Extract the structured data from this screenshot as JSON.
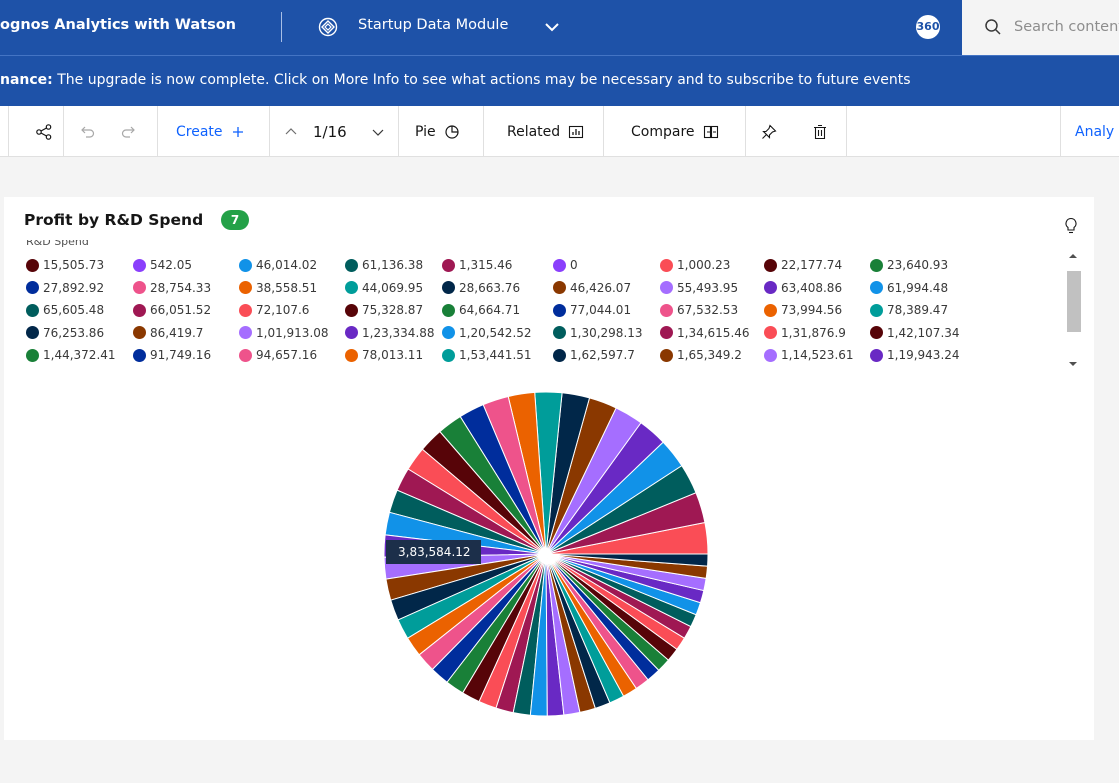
{
  "header": {
    "app_title": "ognos Analytics with Watson",
    "module_name": "Startup Data Module",
    "badge": "360",
    "search_placeholder": "Search content"
  },
  "notice": {
    "label": "nance:",
    "message": " The upgrade is now complete. Click on More Info to see what actions may be necessary and to subscribe to future events"
  },
  "toolbar": {
    "create_label": "Create",
    "page_indicator": "1/16",
    "pie_label": "Pie",
    "related_label": "Related",
    "compare_label": "Compare",
    "analyze_label": "Analy"
  },
  "card": {
    "title": "Profit by R&D Spend",
    "badge": "7",
    "legend_title": "R&D Spend"
  },
  "chart_data": {
    "type": "pie",
    "title": "Profit by R&D Spend",
    "legend_title": "R&D Spend",
    "legend_placement": "top",
    "palette": [
      "#570408",
      "#8a3ffc",
      "#1192e8",
      "#005d5d",
      "#9f1853",
      "#8a3ffc",
      "#fa4d56",
      "#570408",
      "#198038",
      "#002d9c",
      "#ee538b",
      "#eb6200",
      "#009d9a",
      "#012749",
      "#8a3800",
      "#a56eff",
      "#6929c4",
      "#1192e8"
    ],
    "categories": [
      "15,505.73",
      "542.05",
      "46,014.02",
      "61,136.38",
      "1,315.46",
      "0",
      "1,000.23",
      "22,177.74",
      "23,640.93",
      "27,892.92",
      "28,754.33",
      "38,558.51",
      "44,069.95",
      "28,663.76",
      "46,426.07",
      "55,493.95",
      "63,408.86",
      "61,994.48",
      "65,605.48",
      "66,051.52",
      "72,107.6",
      "75,328.87",
      "64,664.71",
      "77,044.01",
      "67,532.53",
      "73,994.56",
      "78,389.47",
      "76,253.86",
      "86,419.7",
      "1,01,913.08",
      "1,23,334.88",
      "1,20,542.52",
      "1,30,298.13",
      "1,34,615.46",
      "1,31,876.9",
      "1,42,107.34",
      "1,44,372.41",
      "91,749.16",
      "94,657.16",
      "78,013.11",
      "1,53,441.51",
      "1,62,597.7",
      "1,65,349.2",
      "1,14,523.61",
      "1,19,943.24"
    ],
    "legend_colors": [
      "#570408",
      "#8a3ffc",
      "#1192e8",
      "#005d5d",
      "#9f1853",
      "#8a3ffc",
      "#fa4d56",
      "#570408",
      "#198038",
      "#002d9c",
      "#ee538b",
      "#eb6200",
      "#009d9a",
      "#012749",
      "#8a3800",
      "#a56eff",
      "#6929c4",
      "#1192e8",
      "#005d5d",
      "#9f1853",
      "#fa4d56",
      "#570408",
      "#198038",
      "#002d9c",
      "#ee538b",
      "#eb6200",
      "#009d9a",
      "#012749",
      "#8a3800",
      "#a56eff",
      "#6929c4",
      "#1192e8",
      "#005d5d",
      "#9f1853",
      "#fa4d56",
      "#570408",
      "#198038",
      "#002d9c",
      "#ee538b",
      "#eb6200",
      "#009d9a",
      "#012749",
      "#8a3800",
      "#a56eff",
      "#6929c4"
    ],
    "slice_count": 50,
    "slice_colors": [
      "#fa4d56",
      "#9f1853",
      "#005d5d",
      "#1192e8",
      "#6929c4",
      "#a56eff",
      "#8a3800",
      "#012749",
      "#009d9a",
      "#eb6200",
      "#ee538b",
      "#002d9c",
      "#198038",
      "#570408",
      "#fa4d56",
      "#9f1853",
      "#005d5d",
      "#1192e8",
      "#6929c4",
      "#a56eff",
      "#8a3800",
      "#012749",
      "#009d9a",
      "#eb6200",
      "#ee538b",
      "#002d9c",
      "#198038",
      "#570408",
      "#fa4d56",
      "#9f1853",
      "#005d5d",
      "#1192e8",
      "#6929c4",
      "#a56eff",
      "#8a3800",
      "#012749",
      "#009d9a",
      "#eb6200",
      "#ee538b",
      "#002d9c",
      "#198038",
      "#570408",
      "#fa4d56",
      "#9f1853",
      "#005d5d",
      "#1192e8",
      "#6929c4",
      "#a56eff",
      "#8a3800",
      "#012749"
    ],
    "tooltip_value": "3,83,584.12"
  }
}
